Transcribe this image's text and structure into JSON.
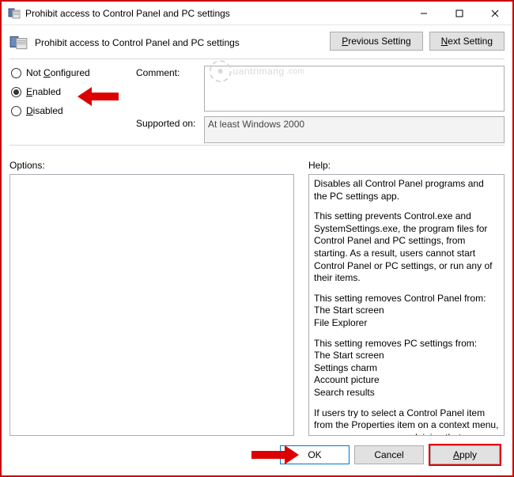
{
  "window": {
    "title": "Prohibit access to Control Panel and PC settings"
  },
  "header": {
    "title": "Prohibit access to Control Panel and PC settings"
  },
  "nav": {
    "previous": "Previous Setting",
    "next": "Next Setting"
  },
  "radio": {
    "not_configured": "Not Configured",
    "enabled": "Enabled",
    "disabled": "Disabled",
    "selected": "enabled"
  },
  "fields": {
    "comment_label": "Comment:",
    "comment_value": "",
    "supported_label": "Supported on:",
    "supported_value": "At least Windows 2000"
  },
  "sections": {
    "options_label": "Options:",
    "help_label": "Help:"
  },
  "help": {
    "p1": "Disables all Control Panel programs and the PC settings app.",
    "p2": "This setting prevents Control.exe and SystemSettings.exe, the program files for Control Panel and PC settings, from starting. As a result, users cannot start Control Panel or PC settings, or run any of their items.",
    "p3a": "This setting removes Control Panel from:",
    "p3b": "The Start screen",
    "p3c": "File Explorer",
    "p4a": "This setting removes PC settings from:",
    "p4b": "The Start screen",
    "p4c": "Settings charm",
    "p4d": "Account picture",
    "p4e": "Search results",
    "p5": "If users try to select a Control Panel item from the Properties item on a context menu, a message appears explaining that a setting prevents the action."
  },
  "footer": {
    "ok": "OK",
    "cancel": "Cancel",
    "apply": "Apply"
  },
  "watermark": "uantrimang"
}
